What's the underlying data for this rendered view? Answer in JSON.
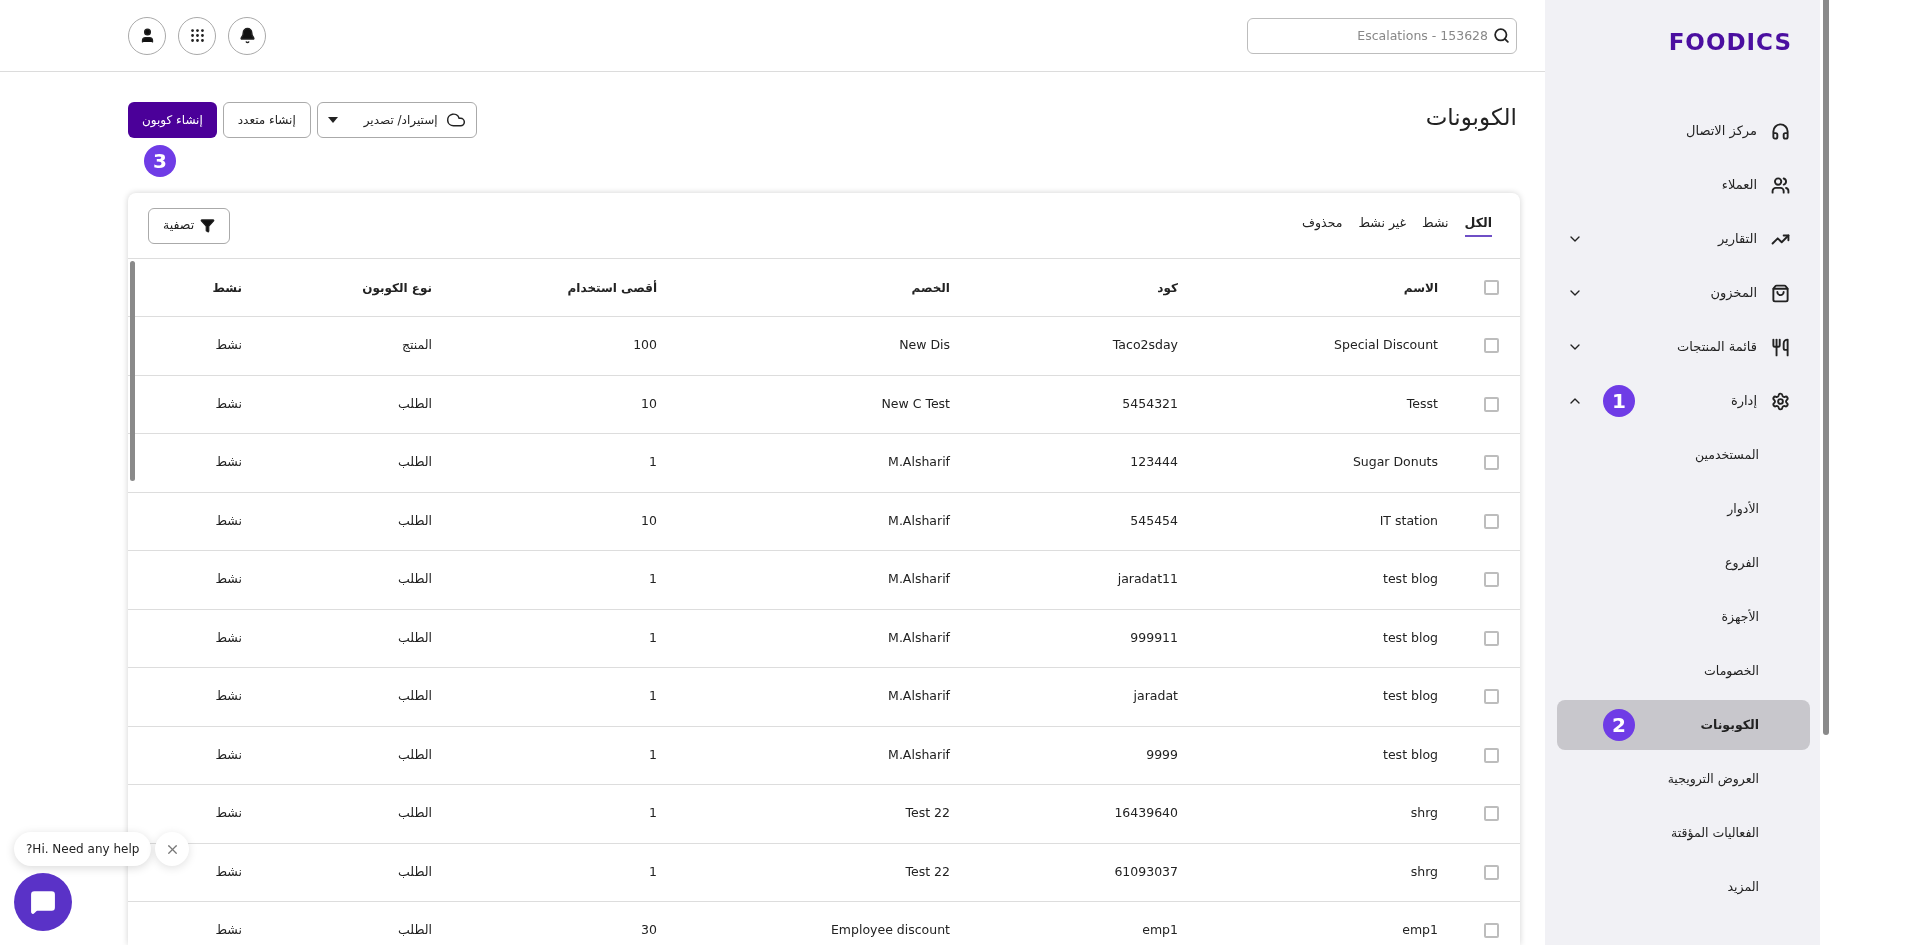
{
  "topbar": {
    "search": {
      "placeholder": "Escalations - 153628"
    }
  },
  "page": {
    "title": "الكوبونات",
    "actions": [
      {
        "kind": "dropdown",
        "label": "إستيراد/ تصدير"
      },
      {
        "kind": "outline",
        "label": "إنشاء متعدد"
      },
      {
        "kind": "primary",
        "label": "إنشاء كوبون",
        "marker": "3"
      }
    ]
  },
  "tabs": [
    {
      "label": "الكل",
      "selected": true
    },
    {
      "label": "نشط",
      "selected": false
    },
    {
      "label": "غير نشط",
      "selected": false
    },
    {
      "label": "محذوف",
      "selected": false
    }
  ],
  "filter_button": "تصفية",
  "table": {
    "select_all_checked": false,
    "columns": [
      "الاسم",
      "كود",
      "الخصم",
      "أقصى استخدام",
      "نوع الكوبون",
      "نشط"
    ],
    "rows": [
      {
        "checked": false,
        "cells": [
          "Special Discount",
          "Taco2sday",
          "New Dis",
          "100",
          "المنتج",
          "نشط"
        ]
      },
      {
        "checked": false,
        "cells": [
          "Tesst",
          "5454321",
          "New C Test",
          "10",
          "الطلب",
          "نشط"
        ]
      },
      {
        "checked": false,
        "cells": [
          "Sugar Donuts",
          "123444",
          "M.Alsharif",
          "1",
          "الطلب",
          "نشط"
        ]
      },
      {
        "checked": false,
        "cells": [
          "IT station",
          "545454",
          "M.Alsharif",
          "10",
          "الطلب",
          "نشط"
        ]
      },
      {
        "checked": false,
        "cells": [
          "test blog",
          "jaradat11",
          "M.Alsharif",
          "1",
          "الطلب",
          "نشط"
        ]
      },
      {
        "checked": false,
        "cells": [
          "test blog",
          "999911",
          "M.Alsharif",
          "1",
          "الطلب",
          "نشط"
        ]
      },
      {
        "checked": false,
        "cells": [
          "test blog",
          "jaradat",
          "M.Alsharif",
          "1",
          "الطلب",
          "نشط"
        ]
      },
      {
        "checked": false,
        "cells": [
          "test blog",
          "9999",
          "M.Alsharif",
          "1",
          "الطلب",
          "نشط"
        ]
      },
      {
        "checked": false,
        "cells": [
          "shrg",
          "16439640",
          "Test 22",
          "1",
          "الطلب",
          "نشط"
        ]
      },
      {
        "checked": false,
        "cells": [
          "shrg",
          "61093037",
          "Test 22",
          "1",
          "الطلب",
          "نشط"
        ]
      },
      {
        "checked": false,
        "cells": [
          "emp1",
          "emp1",
          "Employee discount",
          "30",
          "الطلب",
          "نشط"
        ]
      }
    ]
  },
  "sidebar": {
    "logo": "FOODICS",
    "items": [
      {
        "label": "مركز الاتصال",
        "selected": false
      },
      {
        "label": "العملاء",
        "selected": false
      },
      {
        "label": "التقارير",
        "selected": false,
        "expanded": false
      },
      {
        "label": "المخزون",
        "selected": false,
        "expanded": false
      },
      {
        "label": "قائمة المنتجات",
        "selected": false,
        "expanded": false
      },
      {
        "label": "إدارة",
        "selected": false,
        "expanded": true,
        "marker": "1",
        "children": [
          {
            "label": "المستخدمين",
            "selected": false
          },
          {
            "label": "الأدوار",
            "selected": false
          },
          {
            "label": "الفروع",
            "selected": false
          },
          {
            "label": "الأجهزة",
            "selected": false
          },
          {
            "label": "الخصومات",
            "selected": false
          },
          {
            "label": "الكوبونات",
            "selected": true,
            "marker": "2"
          },
          {
            "label": "العروض الترويجية",
            "selected": false
          },
          {
            "label": "الفعاليات المؤقتة",
            "selected": false
          },
          {
            "label": "المزيد",
            "selected": false
          }
        ]
      }
    ]
  },
  "chat": {
    "message": "?Hi. Need any help"
  }
}
